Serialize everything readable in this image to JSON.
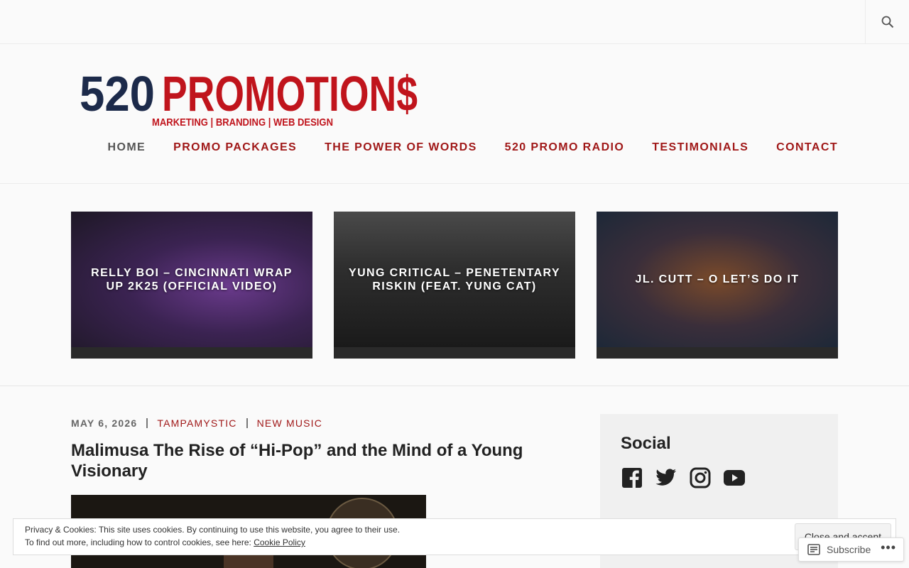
{
  "header": {
    "search_icon": "search-icon",
    "logo": {
      "main_number": "520",
      "main_word": "PROMOTION$",
      "tagline": "MARKETING | BRANDING | WEB DESIGN",
      "colors": {
        "number": "#1c2a4a",
        "word": "#c0141c",
        "tagline": "#c0141c"
      }
    },
    "nav": [
      {
        "label": "HOME",
        "active": true
      },
      {
        "label": "PROMO PACKAGES"
      },
      {
        "label": "THE POWER OF WORDS"
      },
      {
        "label": "520 PROMO RADIO"
      },
      {
        "label": "TESTIMONIALS"
      },
      {
        "label": "CONTACT"
      }
    ]
  },
  "featured": [
    {
      "title": "RELLY BOI – CINCINNATI WRAP UP 2K25 (OFFICIAL VIDEO)"
    },
    {
      "title": "YUNG CRITICAL – PENETENTARY RISKIN (FEAT. YUNG CAT)"
    },
    {
      "title": "JL. CUTT – O LET’S DO IT"
    }
  ],
  "post": {
    "date": "MAY 6, 2026",
    "author": "TAMPAMYSTIC",
    "category": "NEW MUSIC",
    "title": "Malimusa The Rise of “Hi-Pop” and the Mind of a Young Visionary"
  },
  "sidebar": {
    "heading": "Social",
    "icons": [
      "facebook-icon",
      "twitter-icon",
      "instagram-icon",
      "youtube-icon"
    ]
  },
  "cookie": {
    "line1": "Privacy & Cookies: This site uses cookies. By continuing to use this website, you agree to their use.",
    "line2_prefix": "To find out more, including how to control cookies, see here:",
    "policy_link": "Cookie Policy",
    "accept_label": "Close and accept"
  },
  "subscribe": {
    "label": "Subscribe",
    "more": "•••"
  },
  "colors": {
    "accent": "#a01818",
    "background": "#fafafa"
  }
}
